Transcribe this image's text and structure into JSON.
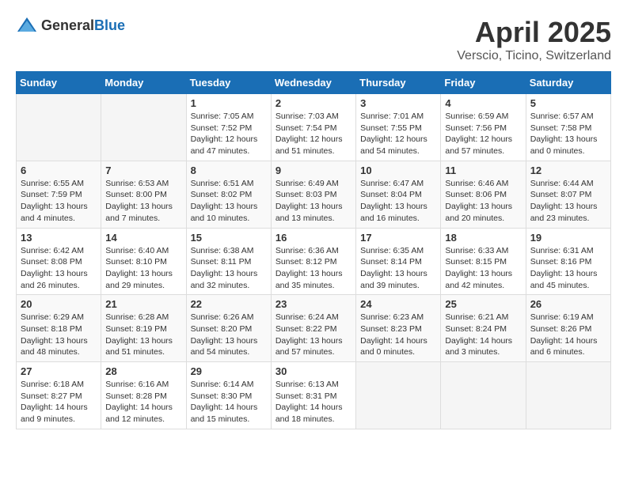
{
  "logo": {
    "general": "General",
    "blue": "Blue"
  },
  "header": {
    "title": "April 2025",
    "subtitle": "Verscio, Ticino, Switzerland"
  },
  "weekdays": [
    "Sunday",
    "Monday",
    "Tuesday",
    "Wednesday",
    "Thursday",
    "Friday",
    "Saturday"
  ],
  "weeks": [
    [
      {
        "day": "",
        "info": ""
      },
      {
        "day": "",
        "info": ""
      },
      {
        "day": "1",
        "info": "Sunrise: 7:05 AM\nSunset: 7:52 PM\nDaylight: 12 hours and 47 minutes."
      },
      {
        "day": "2",
        "info": "Sunrise: 7:03 AM\nSunset: 7:54 PM\nDaylight: 12 hours and 51 minutes."
      },
      {
        "day": "3",
        "info": "Sunrise: 7:01 AM\nSunset: 7:55 PM\nDaylight: 12 hours and 54 minutes."
      },
      {
        "day": "4",
        "info": "Sunrise: 6:59 AM\nSunset: 7:56 PM\nDaylight: 12 hours and 57 minutes."
      },
      {
        "day": "5",
        "info": "Sunrise: 6:57 AM\nSunset: 7:58 PM\nDaylight: 13 hours and 0 minutes."
      }
    ],
    [
      {
        "day": "6",
        "info": "Sunrise: 6:55 AM\nSunset: 7:59 PM\nDaylight: 13 hours and 4 minutes."
      },
      {
        "day": "7",
        "info": "Sunrise: 6:53 AM\nSunset: 8:00 PM\nDaylight: 13 hours and 7 minutes."
      },
      {
        "day": "8",
        "info": "Sunrise: 6:51 AM\nSunset: 8:02 PM\nDaylight: 13 hours and 10 minutes."
      },
      {
        "day": "9",
        "info": "Sunrise: 6:49 AM\nSunset: 8:03 PM\nDaylight: 13 hours and 13 minutes."
      },
      {
        "day": "10",
        "info": "Sunrise: 6:47 AM\nSunset: 8:04 PM\nDaylight: 13 hours and 16 minutes."
      },
      {
        "day": "11",
        "info": "Sunrise: 6:46 AM\nSunset: 8:06 PM\nDaylight: 13 hours and 20 minutes."
      },
      {
        "day": "12",
        "info": "Sunrise: 6:44 AM\nSunset: 8:07 PM\nDaylight: 13 hours and 23 minutes."
      }
    ],
    [
      {
        "day": "13",
        "info": "Sunrise: 6:42 AM\nSunset: 8:08 PM\nDaylight: 13 hours and 26 minutes."
      },
      {
        "day": "14",
        "info": "Sunrise: 6:40 AM\nSunset: 8:10 PM\nDaylight: 13 hours and 29 minutes."
      },
      {
        "day": "15",
        "info": "Sunrise: 6:38 AM\nSunset: 8:11 PM\nDaylight: 13 hours and 32 minutes."
      },
      {
        "day": "16",
        "info": "Sunrise: 6:36 AM\nSunset: 8:12 PM\nDaylight: 13 hours and 35 minutes."
      },
      {
        "day": "17",
        "info": "Sunrise: 6:35 AM\nSunset: 8:14 PM\nDaylight: 13 hours and 39 minutes."
      },
      {
        "day": "18",
        "info": "Sunrise: 6:33 AM\nSunset: 8:15 PM\nDaylight: 13 hours and 42 minutes."
      },
      {
        "day": "19",
        "info": "Sunrise: 6:31 AM\nSunset: 8:16 PM\nDaylight: 13 hours and 45 minutes."
      }
    ],
    [
      {
        "day": "20",
        "info": "Sunrise: 6:29 AM\nSunset: 8:18 PM\nDaylight: 13 hours and 48 minutes."
      },
      {
        "day": "21",
        "info": "Sunrise: 6:28 AM\nSunset: 8:19 PM\nDaylight: 13 hours and 51 minutes."
      },
      {
        "day": "22",
        "info": "Sunrise: 6:26 AM\nSunset: 8:20 PM\nDaylight: 13 hours and 54 minutes."
      },
      {
        "day": "23",
        "info": "Sunrise: 6:24 AM\nSunset: 8:22 PM\nDaylight: 13 hours and 57 minutes."
      },
      {
        "day": "24",
        "info": "Sunrise: 6:23 AM\nSunset: 8:23 PM\nDaylight: 14 hours and 0 minutes."
      },
      {
        "day": "25",
        "info": "Sunrise: 6:21 AM\nSunset: 8:24 PM\nDaylight: 14 hours and 3 minutes."
      },
      {
        "day": "26",
        "info": "Sunrise: 6:19 AM\nSunset: 8:26 PM\nDaylight: 14 hours and 6 minutes."
      }
    ],
    [
      {
        "day": "27",
        "info": "Sunrise: 6:18 AM\nSunset: 8:27 PM\nDaylight: 14 hours and 9 minutes."
      },
      {
        "day": "28",
        "info": "Sunrise: 6:16 AM\nSunset: 8:28 PM\nDaylight: 14 hours and 12 minutes."
      },
      {
        "day": "29",
        "info": "Sunrise: 6:14 AM\nSunset: 8:30 PM\nDaylight: 14 hours and 15 minutes."
      },
      {
        "day": "30",
        "info": "Sunrise: 6:13 AM\nSunset: 8:31 PM\nDaylight: 14 hours and 18 minutes."
      },
      {
        "day": "",
        "info": ""
      },
      {
        "day": "",
        "info": ""
      },
      {
        "day": "",
        "info": ""
      }
    ]
  ]
}
